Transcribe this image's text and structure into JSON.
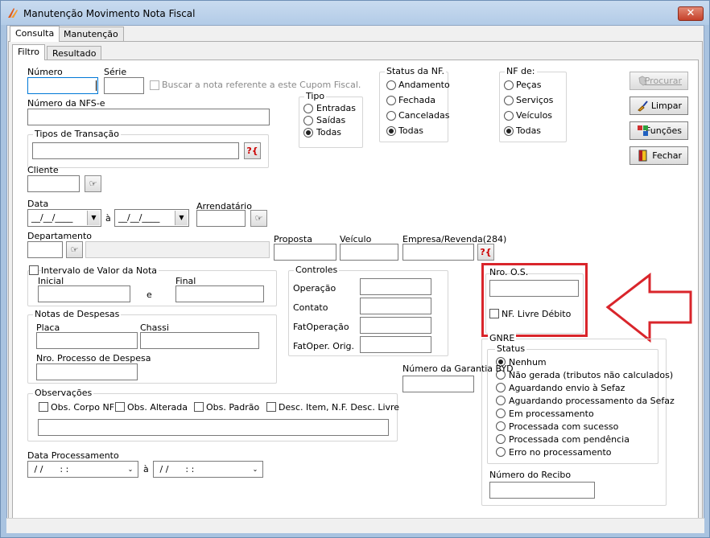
{
  "window": {
    "title": "Manutenção Movimento Nota Fiscal",
    "close_label": "✕"
  },
  "tabs": {
    "consulta": "Consulta",
    "manutencao": "Manutenção"
  },
  "subtabs": {
    "filtro": "Filtro",
    "resultado": "Resultado"
  },
  "fields": {
    "numero": "Número",
    "serie": "Série",
    "buscar_cupom": "Buscar a nota referente a este Cupom Fiscal.",
    "numero_nfse": "Número da NFS-e",
    "tipos_transacao": "Tipos de Transação",
    "cliente": "Cliente",
    "data": "Data",
    "data_from": "__/__/____",
    "data_sep": "à",
    "data_to": "__/__/____",
    "arrendatario": "Arrendatário",
    "departamento": "Departamento",
    "proposta": "Proposta",
    "veiculo": "Veículo",
    "empresa_revenda": "Empresa/Revenda(284)",
    "intervalo_valor": "Intervalo de Valor da Nota",
    "inicial": "Inicial",
    "e": "e",
    "final": "Final",
    "notas_despesas": "Notas de Despesas",
    "placa": "Placa",
    "chassi": "Chassi",
    "nro_processo": "Nro. Processo de Despesa",
    "observacoes": "Observações",
    "obs_corpo": "Obs. Corpo NF",
    "obs_alterada": "Obs. Alterada",
    "obs_padrao": "Obs. Padrão",
    "desc_item": "Desc. Item, N.F. Desc. Livre",
    "data_processamento": "Data Processamento",
    "dp_from": " / /      : :",
    "dp_sep": "à",
    "dp_to": " / /      : :",
    "numero_garantia": "Número da Garantia BYD",
    "nro_os": "Nro. O.S.",
    "nf_livre_debito": "NF. Livre Débito",
    "numero_recibo": "Número do Recibo"
  },
  "tipo": {
    "title": "Tipo",
    "options": [
      "Entradas",
      "Saídas",
      "Todas"
    ],
    "selected": 2
  },
  "status_nf": {
    "title": "Status da NF.",
    "options": [
      "Andamento",
      "Fechada",
      "Canceladas",
      "Todas"
    ],
    "selected": 3
  },
  "nf_de": {
    "title": "NF de:",
    "options": [
      "Peças",
      "Serviços",
      "Veículos",
      "Todas"
    ],
    "selected": 3
  },
  "controles": {
    "title": "Controles",
    "rows": [
      "Operação",
      "Contato",
      "FatOperação",
      "FatOper. Orig."
    ]
  },
  "gnre": {
    "title": "GNRE",
    "status_title": "Status",
    "options": [
      "Nenhum",
      "Não gerada (tributos não calculados)",
      "Aguardando envio à Sefaz",
      "Aguardando processamento da Sefaz",
      "Em processamento",
      "Processada com sucesso",
      "Processada com pendência",
      "Erro no processamento"
    ],
    "selected": 0
  },
  "buttons": {
    "procurar": "Procurar",
    "limpar": "Limpar",
    "funcoes": "Funções",
    "fechar": "Fechar",
    "lookup_q": "?{",
    "lookup_hand": "☞"
  },
  "colors": {
    "annotation_red": "#d9252b",
    "accent_blue": "#0078d7"
  }
}
